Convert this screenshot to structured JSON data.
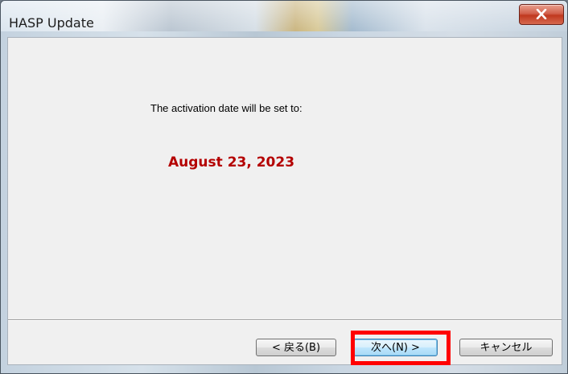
{
  "window": {
    "title": "HASP Update",
    "close_icon": "close-icon"
  },
  "content": {
    "activation_label": "The activation date will be set to:",
    "activation_date": "August 23, 2023"
  },
  "buttons": {
    "back_label": "< 戻る(B)",
    "next_label": "次へ(N) >",
    "cancel_label": "キャンセル"
  },
  "colors": {
    "date_text": "#b40000",
    "highlight_border": "#ff0000",
    "close_button": "#c0391f"
  }
}
